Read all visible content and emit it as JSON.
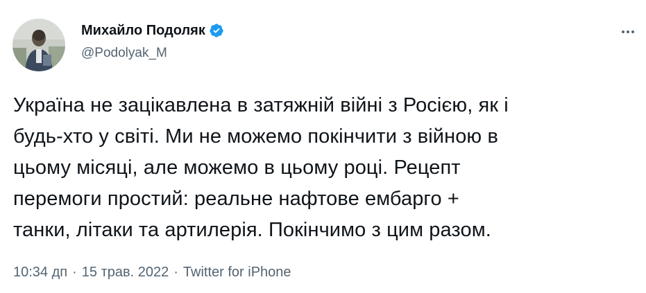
{
  "author": {
    "display_name": "Михайло Подоляк",
    "handle": "@Podolyak_M",
    "verified_icon": "verified-badge-icon",
    "verified_color": "#1d9bf0"
  },
  "tweet": {
    "lines": [
      "Україна не зацікавлена в затяжній війні з Росією, як і",
      "будь-хто у світі. Ми не можемо покінчити з війною в",
      "цьому місяці, але можемо в цьому році. Рецепт",
      "перемоги простий: реальне нафтове ембарго +",
      "танки, літаки та артилерія. Покінчимо з цим разом."
    ]
  },
  "meta": {
    "time": "10:34 дп",
    "separator": "·",
    "date": "15 трав. 2022",
    "source": "Twitter for iPhone"
  },
  "more_icon": "more-options-icon",
  "colors": {
    "text": "#0f1419",
    "secondary": "#536471",
    "background": "#ffffff"
  }
}
